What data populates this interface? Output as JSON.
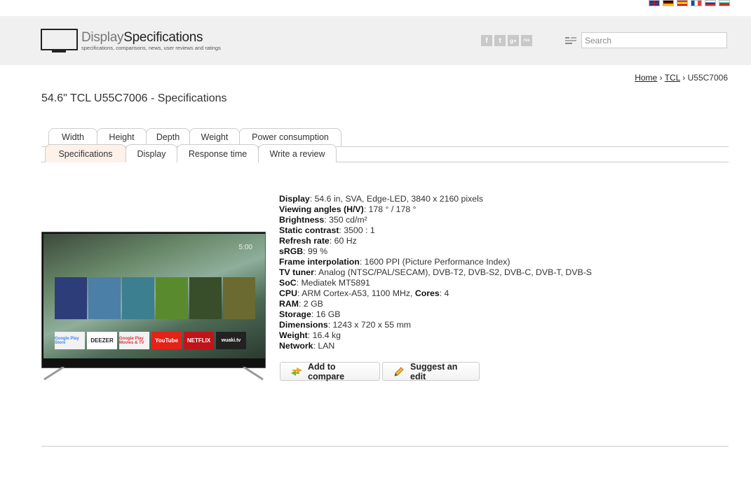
{
  "header": {
    "logo_part1": "Display",
    "logo_part2": "Specifications",
    "logo_tagline": "specifications, comparisons, news, user reviews and ratings",
    "search_placeholder": "Search",
    "social": [
      "facebook-icon",
      "twitter-icon",
      "google-plus-icon",
      "rss-icon"
    ],
    "social_glyphs": [
      "f",
      "t",
      "g+",
      "rss"
    ]
  },
  "flags": [
    "en",
    "de",
    "es",
    "fr",
    "ru",
    "bg"
  ],
  "breadcrumb": {
    "home": "Home",
    "brand": "TCL",
    "model": "U55C7006",
    "sep": "›"
  },
  "page_title": "54.6\" TCL U55C7006 - Specifications",
  "tabs_row1": [
    "Width",
    "Height",
    "Depth",
    "Weight",
    "Power consumption"
  ],
  "tabs_row2": [
    "Specifications",
    "Display",
    "Response time",
    "Write a review"
  ],
  "active_tab": "Specifications",
  "specs": [
    {
      "label": "Display",
      "value": ": 54.6 in, SVA, Edge-LED, 3840 x 2160 pixels"
    },
    {
      "label": "Viewing angles (H/V)",
      "value": ": 178 ° / 178 °"
    },
    {
      "label": "Brightness",
      "value": ": 350 cd/m²"
    },
    {
      "label": "Static contrast",
      "value": ": 3500 : 1"
    },
    {
      "label": "Refresh rate",
      "value": ": 60 Hz"
    },
    {
      "label": "sRGB",
      "value": ": 99 %"
    },
    {
      "label": "Frame interpolation",
      "value": ": 1600 PPI (Picture Performance Index)"
    },
    {
      "label": "TV tuner",
      "value": ": Analog (NTSC/PAL/SECAM), DVB-T2, DVB-S2, DVB-C, DVB-T, DVB-S"
    },
    {
      "label": "SoC",
      "value": ": Mediatek MT5891"
    },
    {
      "label": "CPU",
      "value": ": ARM Cortex-A53, 1100 MHz, ",
      "label2": "Cores",
      "value2": ": 4"
    },
    {
      "label": "RAM",
      "value": ": 2 GB"
    },
    {
      "label": "Storage",
      "value": ": 16 GB"
    },
    {
      "label": "Dimensions",
      "value": ": 1243 x 720 x 55 mm"
    },
    {
      "label": "Weight",
      "value": ": 16.4 kg"
    },
    {
      "label": "Network",
      "value": ": LAN"
    }
  ],
  "buttons": {
    "compare": "Add to compare",
    "edit": "Suggest an edit"
  },
  "tv_screen": {
    "time": "5:00",
    "apps": [
      "Google Play Store",
      "DEEZER",
      "Google Play Movies & TV",
      "YouTube",
      "NETFLIX",
      "wuaki.tv"
    ]
  }
}
